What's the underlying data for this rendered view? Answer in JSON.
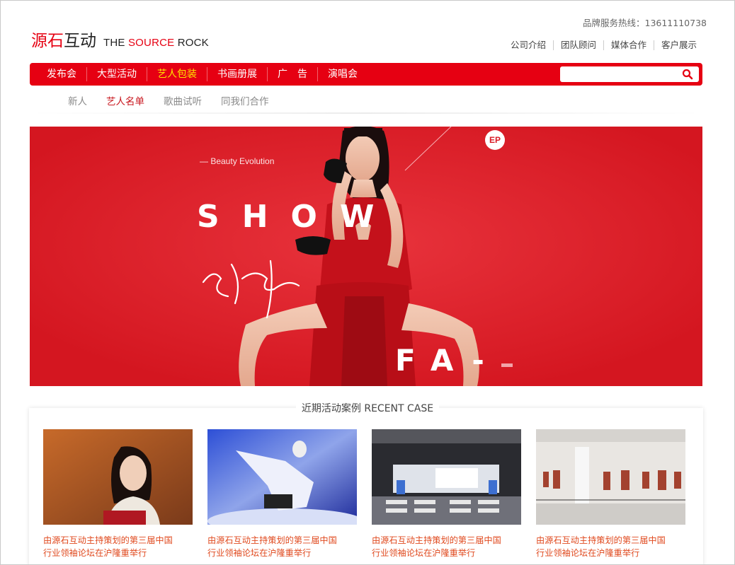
{
  "brand": {
    "cn_red": "源石",
    "cn_black": "互动",
    "en_black_1": "THE ",
    "en_red": "SOURCE",
    "en_black_2": " ROCK"
  },
  "hotline": "品牌服务热线：13611110738",
  "top_links": [
    "公司介绍",
    "团队顾问",
    "媒体合作",
    "客户展示"
  ],
  "nav": {
    "items": [
      "发布会",
      "大型活动",
      "艺人包装",
      "书画册展",
      "广　告",
      "演唱会"
    ],
    "active_index": 2
  },
  "search": {
    "placeholder": "",
    "value": ""
  },
  "subnav": {
    "items": [
      "新人",
      "艺人名单",
      "歌曲试听",
      "同我们合作"
    ],
    "active_index": 1
  },
  "banner": {
    "tagline": "— Beauty Evolution",
    "show_text": "SHOW",
    "fa_text": "FA-",
    "badge": "EP"
  },
  "recent_case": {
    "title": "近期活动案例 RECENT CASE",
    "items": [
      {
        "caption_line1": "由源石互动主持策划的第三届中国",
        "caption_line2": "行业领袖论坛在沪隆重举行"
      },
      {
        "caption_line1": "由源石互动主持策划的第三届中国",
        "caption_line2": "行业领袖论坛在沪隆重举行"
      },
      {
        "caption_line1": "由源石互动主持策划的第三届中国",
        "caption_line2": "行业领袖论坛在沪隆重举行"
      },
      {
        "caption_line1": "由源石互动主持策划的第三届中国",
        "caption_line2": "行业领袖论坛在沪隆重举行"
      }
    ]
  },
  "colors": {
    "brand_red": "#e60012",
    "active_yellow": "#ffe400",
    "caption_orange": "#e04a1f",
    "banner_red": "#d91a24"
  }
}
